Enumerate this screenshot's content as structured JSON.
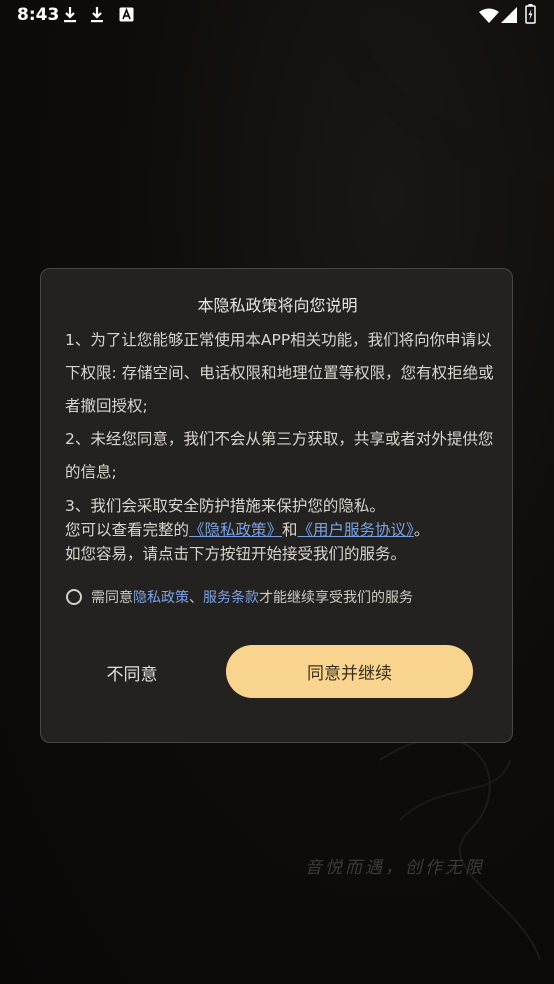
{
  "status_bar": {
    "time": "8:43",
    "icons": [
      "download-icon",
      "download-icon",
      "a-box-icon",
      "wifi-icon",
      "signal-icon",
      "battery-charging-icon"
    ]
  },
  "dialog": {
    "title": "本隐私政策将向您说明",
    "paragraphs": {
      "p1": "1、为了让您能够正常使用本APP相关功能，我们将向你申请以下权限: 存储空间、电话权限和地理位置等权限，您有权拒绝或者撤回授权;",
      "p2": "2、未经您同意，我们不会从第三方获取，共享或者对外提供您的信息;",
      "p3_line1": "3、我们会采取安全防护措施来保护您的隐私。",
      "p3_line2_prefix": "您可以查看完整的",
      "p3_link_privacy": "《隐私政策》",
      "p3_and": "和",
      "p3_link_agreement": "《用户服务协议》",
      "p3_period": "。",
      "p3_line3": "如您容易，请点击下方按钮开始接受我们的服务。"
    },
    "agree_row": {
      "prefix": "需同意",
      "link_privacy": "隐私政策",
      "sep": "、",
      "link_terms": "服务条款",
      "suffix": "才能继续享受我们的服务"
    },
    "buttons": {
      "disagree": "不同意",
      "agree": "同意并继续"
    }
  },
  "background": {
    "slogan": "音悦而遇，创作无限"
  },
  "colors": {
    "accent_button": "#f9d48e",
    "link": "#7aa2e6",
    "dialog_bg": "#242220"
  }
}
